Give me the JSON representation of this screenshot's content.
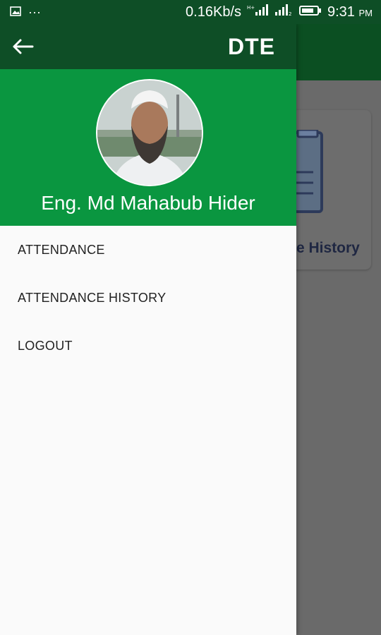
{
  "status_bar": {
    "speed": "0.16Kb/s",
    "time": "9:31",
    "ampm": "PM",
    "icons": [
      "image-icon",
      "more-dots-icon",
      "signal-icon",
      "signal-icon",
      "battery-icon"
    ]
  },
  "drawer": {
    "title": "DTE",
    "back_icon": "arrow-left-icon",
    "user_name": "Eng. Md Mahabub Hider",
    "menu": [
      {
        "label": "ATTENDANCE"
      },
      {
        "label": "ATTENDANCE HISTORY"
      },
      {
        "label": "LOGOUT"
      }
    ]
  },
  "background": {
    "card_text": "e History"
  },
  "colors": {
    "toolbar_dark_green": "#0e4e26",
    "header_green": "#0a9640",
    "drawer_bg": "#fafafa"
  }
}
